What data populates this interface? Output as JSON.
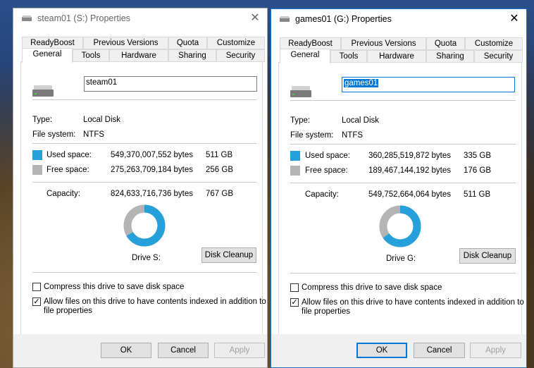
{
  "tabs_row1": [
    "ReadyBoost",
    "Previous Versions",
    "Quota",
    "Customize"
  ],
  "tabs_row2": [
    "General",
    "Tools",
    "Hardware",
    "Sharing",
    "Security"
  ],
  "labels": {
    "type": "Type:",
    "file_system": "File system:",
    "used": "Used space:",
    "free": "Free space:",
    "capacity": "Capacity:",
    "cleanup": "Disk Cleanup",
    "compress": "Compress this drive to save disk space",
    "index_line1": "Allow files on this drive to have contents indexed in addition to",
    "index_line2": "file properties",
    "ok": "OK",
    "cancel": "Cancel",
    "apply": "Apply"
  },
  "colors": {
    "used": "#26a0da",
    "free": "#b4b4b4"
  },
  "dialogs": [
    {
      "title": "steam01 (S:) Properties",
      "name": "steam01",
      "type": "Local Disk",
      "fs": "NTFS",
      "used_bytes": "549,370,007,552 bytes",
      "used_gb": "511 GB",
      "free_bytes": "275,263,709,184 bytes",
      "free_gb": "256 GB",
      "cap_bytes": "824,633,716,736 bytes",
      "cap_gb": "767 GB",
      "drive_label": "Drive S:",
      "used_fraction": 0.666,
      "compress_checked": false,
      "index_checked": true
    },
    {
      "title": "games01 (G:) Properties",
      "name": "games01",
      "type": "Local Disk",
      "fs": "NTFS",
      "used_bytes": "360,285,519,872 bytes",
      "used_gb": "335 GB",
      "free_bytes": "189,467,144,192 bytes",
      "free_gb": "176 GB",
      "cap_bytes": "549,752,664,064 bytes",
      "cap_gb": "511 GB",
      "drive_label": "Drive G:",
      "used_fraction": 0.655,
      "compress_checked": false,
      "index_checked": true
    }
  ]
}
